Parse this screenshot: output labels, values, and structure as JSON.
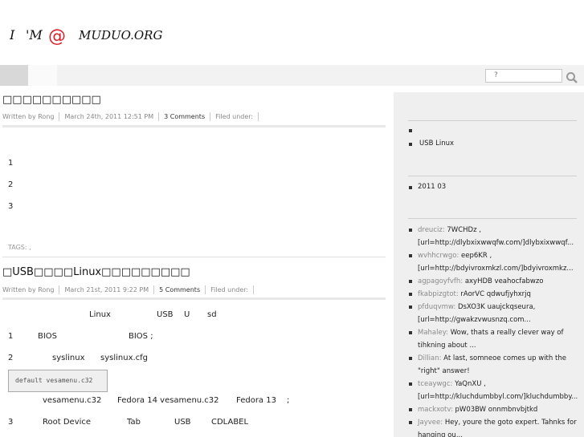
{
  "header": {
    "logo_text": "I 'M @ MUDUO.ORG",
    "search": {
      "placeholder": "?"
    }
  },
  "posts": [
    {
      "title": "□□□□□□□□□□",
      "meta": {
        "author": "Written by Rong",
        "date": "March 24th, 2011 12:51 PM",
        "comments": "3 Comments",
        "filed": "Filed under:"
      },
      "lines": [
        "1",
        "2",
        "3"
      ],
      "tags": "TAGS:  ,"
    },
    {
      "title": "□USB□□□□Linux□□□□□□□□□",
      "meta": {
        "author": "Written by Rong",
        "date": "March 21st, 2011 9:22 PM",
        "comments": "5 Comments",
        "filed": "Filed under:"
      },
      "intro": {
        "a": "Linux",
        "b": "USB",
        "c": "U",
        "d": "sd"
      },
      "step1": {
        "num": "1",
        "a": "BIOS",
        "b": "BIOS ;"
      },
      "step2": {
        "num": "2",
        "a": "syslinux",
        "b": "syslinux.cfg"
      },
      "code": "default vesamenu.c32",
      "after_code": {
        "a": "vesamenu.c32",
        "b": "Fedora 14 vesamenu.c32",
        "c": "Fedora 13",
        "d": ";"
      },
      "step3": {
        "num": "3",
        "a": "Root Device",
        "b": "Tab",
        "c": "USB",
        "d": "CDLABEL"
      }
    }
  ],
  "sidebar": {
    "section1": {
      "item_empty": "",
      "item_usb": "USB   Linux"
    },
    "archive": {
      "item": "2011   03"
    },
    "comments": [
      {
        "who": "dreuciz:",
        "text": "7WCHDz , [url=http://dlybxixwwqfw.com/]dlybxixwwqf..."
      },
      {
        "who": "wvhhcrwgo:",
        "text": "eep6KR , [url=http://bdyivroxmkzl.com/]bdyivroxmkz..."
      },
      {
        "who": "agpagoyfvfh:",
        "text": "axyHDB veahocfabwzo"
      },
      {
        "who": "fkabpizgtot:",
        "text": "rAorVC qdwufjyhxrjq"
      },
      {
        "who": "pfduqvmw:",
        "text": "DsXO3K uaujckqseura, [url=http://gwakzvwusnzq.com..."
      },
      {
        "who": "Mahaley:",
        "text": "Wow, thats a really clever way of tihkning about ..."
      },
      {
        "who": "Dillian:",
        "text": "At last, somneoe comes up with the \"right\" answer!"
      },
      {
        "who": "tceaywgc:",
        "text": "YaQnXU , [url=http://kluchdumbbyl.com/]kluchdumbby..."
      },
      {
        "who": "mackxotv:",
        "text": "pW03BW onnmbnvbjtkd"
      },
      {
        "who": "Jayvee:",
        "text": "Hey, youre the goto expert. Tahnks for hanging ou..."
      }
    ]
  }
}
